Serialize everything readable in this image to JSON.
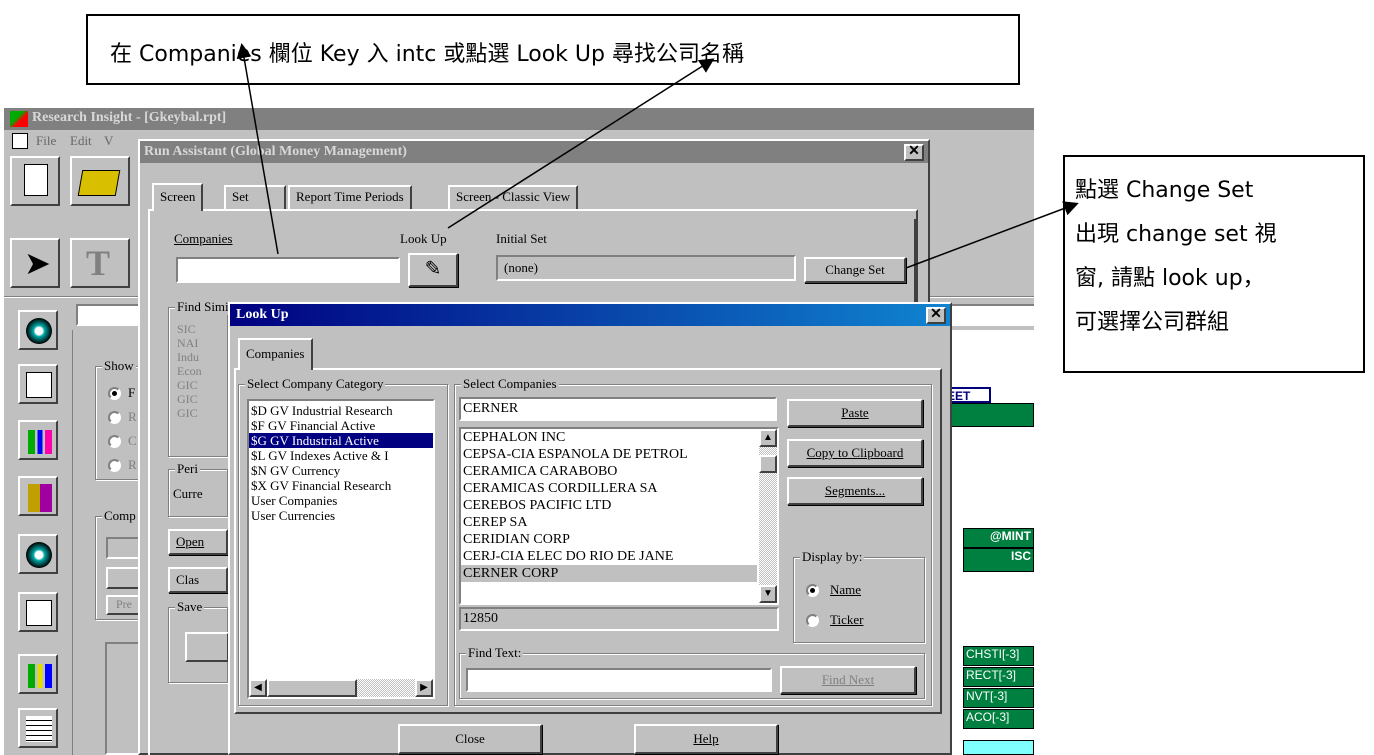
{
  "callouts": {
    "top": "在 Companies  欄位 Key  入 intc  或點選 Look Up 尋找公司名稱",
    "right": [
      "點選  Change Set",
      "出現 change set  視",
      "窗, 請點 look up，",
      "可選擇公司群組"
    ]
  },
  "app": {
    "title": "Research Insight - [Gkeybal.rpt]",
    "menu": [
      "File",
      "Edit",
      "V"
    ]
  },
  "run_assistant": {
    "title": "Run Assistant  (Global Money Management)",
    "tabs": [
      "Screen",
      "Set",
      "Report Time Periods",
      "Screen - Classic View"
    ],
    "companies_label": "Companies",
    "lookup_label": "Look Up",
    "initial_set_label": "Initial Set",
    "initial_set_value": "(none)",
    "change_set": "Change Set",
    "find_similar": "Find Similar Companies",
    "criteria": [
      "SIC",
      "NAI",
      "Indu",
      "Econ",
      "GIC",
      "GIC",
      "GIC"
    ],
    "period_label": "Peri",
    "period_value": "Curre",
    "show_label": "Show",
    "show_opts": [
      "F",
      "R",
      "C",
      "R"
    ],
    "comp_label": "Comp",
    "open": "Open",
    "clas": "Clas",
    "save": "Save",
    "pre": "Pre"
  },
  "lookup": {
    "title": "Look Up",
    "tab": "Companies",
    "category_label": "Select Company Category",
    "categories": [
      "$D GV Industrial Research",
      "$F GV Financial Active",
      "$G GV Industrial Active",
      "$L GV Indexes Active & I",
      "$N GV Currency",
      "$X GV Financial Research",
      "User Companies",
      "User Currencies"
    ],
    "selected_category": 2,
    "companies_label": "Select Companies",
    "search_value": "CERNER",
    "companies": [
      "CEPHALON INC",
      "CEPSA-CIA ESPANOLA DE PETROL",
      "CERAMICA CARABOBO",
      "CERAMICAS CORDILLERA SA",
      "CEREBOS PACIFIC LTD",
      "CEREP SA",
      "CERIDIAN CORP",
      "CERJ-CIA ELEC DO RIO DE JANE",
      "CERNER CORP"
    ],
    "selected_company": 8,
    "code_value": "12850",
    "paste": "Paste",
    "copy": "Copy to Clipboard",
    "segments": "Segments...",
    "display_label": "Display by:",
    "display_name": "Name",
    "display_ticker": "Ticker",
    "find_text_label": "Find Text:",
    "find_next": "Find Next",
    "close": "Close",
    "help": "Help"
  },
  "background_cells": {
    "eet": "EET",
    "mint": "@MINT",
    "isc": "ISC",
    "rows": [
      "CHSTI[-3]",
      "RECT[-3]",
      "NVT[-3]",
      "ACO[-3]"
    ]
  },
  "colors": {
    "titlebar": "#000080",
    "selection": "#000080",
    "green": "#008040"
  }
}
